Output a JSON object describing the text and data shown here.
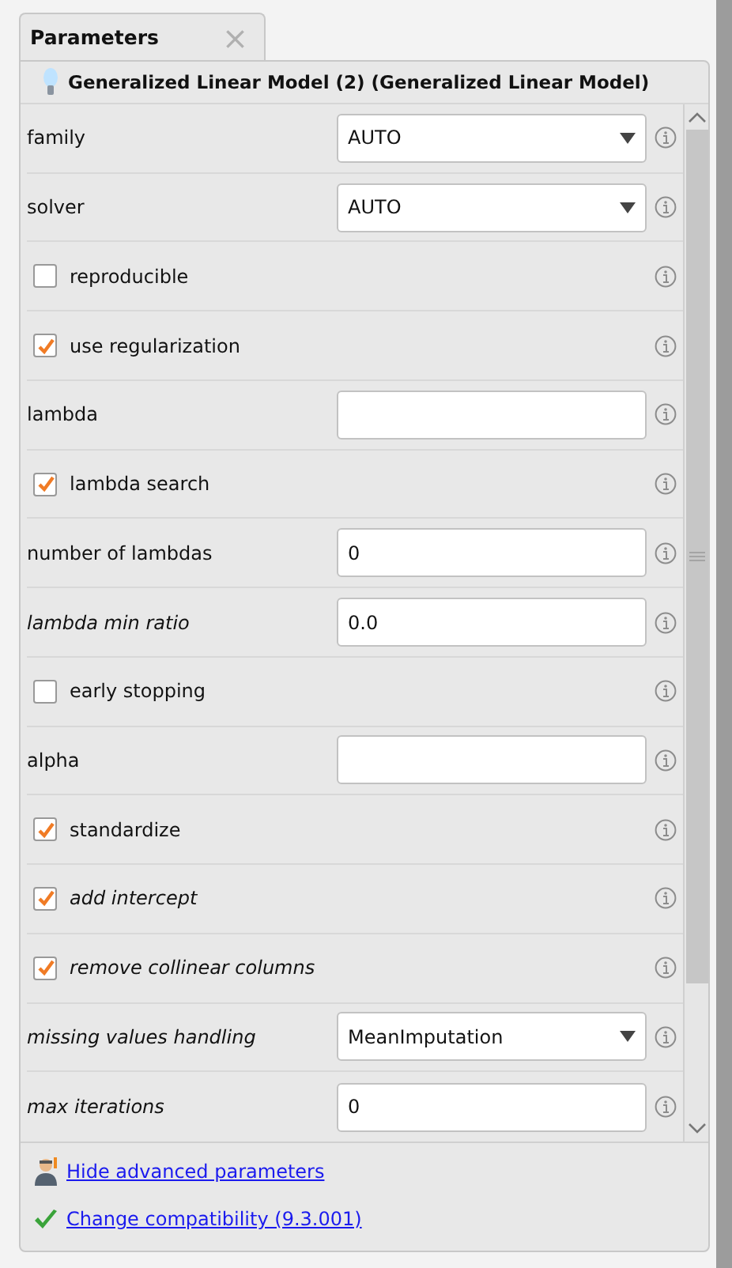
{
  "tab": {
    "label": "Parameters",
    "close": "×"
  },
  "header": {
    "title": "Generalized Linear Model (2) (Generalized Linear Model)"
  },
  "rows": [
    {
      "kind": "select",
      "label": "family",
      "italic": false,
      "value": "AUTO"
    },
    {
      "kind": "select",
      "label": "solver",
      "italic": false,
      "value": "AUTO"
    },
    {
      "kind": "checkbox",
      "label": "reproducible",
      "italic": false,
      "checked": false
    },
    {
      "kind": "checkbox",
      "label": "use regularization",
      "italic": false,
      "checked": true
    },
    {
      "kind": "text",
      "label": "lambda",
      "italic": false,
      "value": ""
    },
    {
      "kind": "checkbox",
      "label": "lambda search",
      "italic": false,
      "checked": true
    },
    {
      "kind": "text",
      "label": "number of lambdas",
      "italic": false,
      "value": "0"
    },
    {
      "kind": "text",
      "label": "lambda min ratio",
      "italic": true,
      "value": "0.0"
    },
    {
      "kind": "checkbox",
      "label": "early stopping",
      "italic": false,
      "checked": false
    },
    {
      "kind": "text",
      "label": "alpha",
      "italic": false,
      "value": ""
    },
    {
      "kind": "checkbox",
      "label": "standardize",
      "italic": false,
      "checked": true
    },
    {
      "kind": "checkbox",
      "label": "add intercept",
      "italic": true,
      "checked": true
    },
    {
      "kind": "checkbox",
      "label": "remove collinear columns",
      "italic": true,
      "checked": true
    },
    {
      "kind": "select",
      "label": "missing values handling",
      "italic": true,
      "value": "MeanImputation"
    },
    {
      "kind": "text",
      "label": "max iterations",
      "italic": true,
      "value": "0"
    }
  ],
  "footer": {
    "links": [
      {
        "kind": "advanced",
        "label": "Hide advanced parameters"
      },
      {
        "kind": "compat",
        "label": "Change compatibility (9.3.001)"
      }
    ]
  }
}
